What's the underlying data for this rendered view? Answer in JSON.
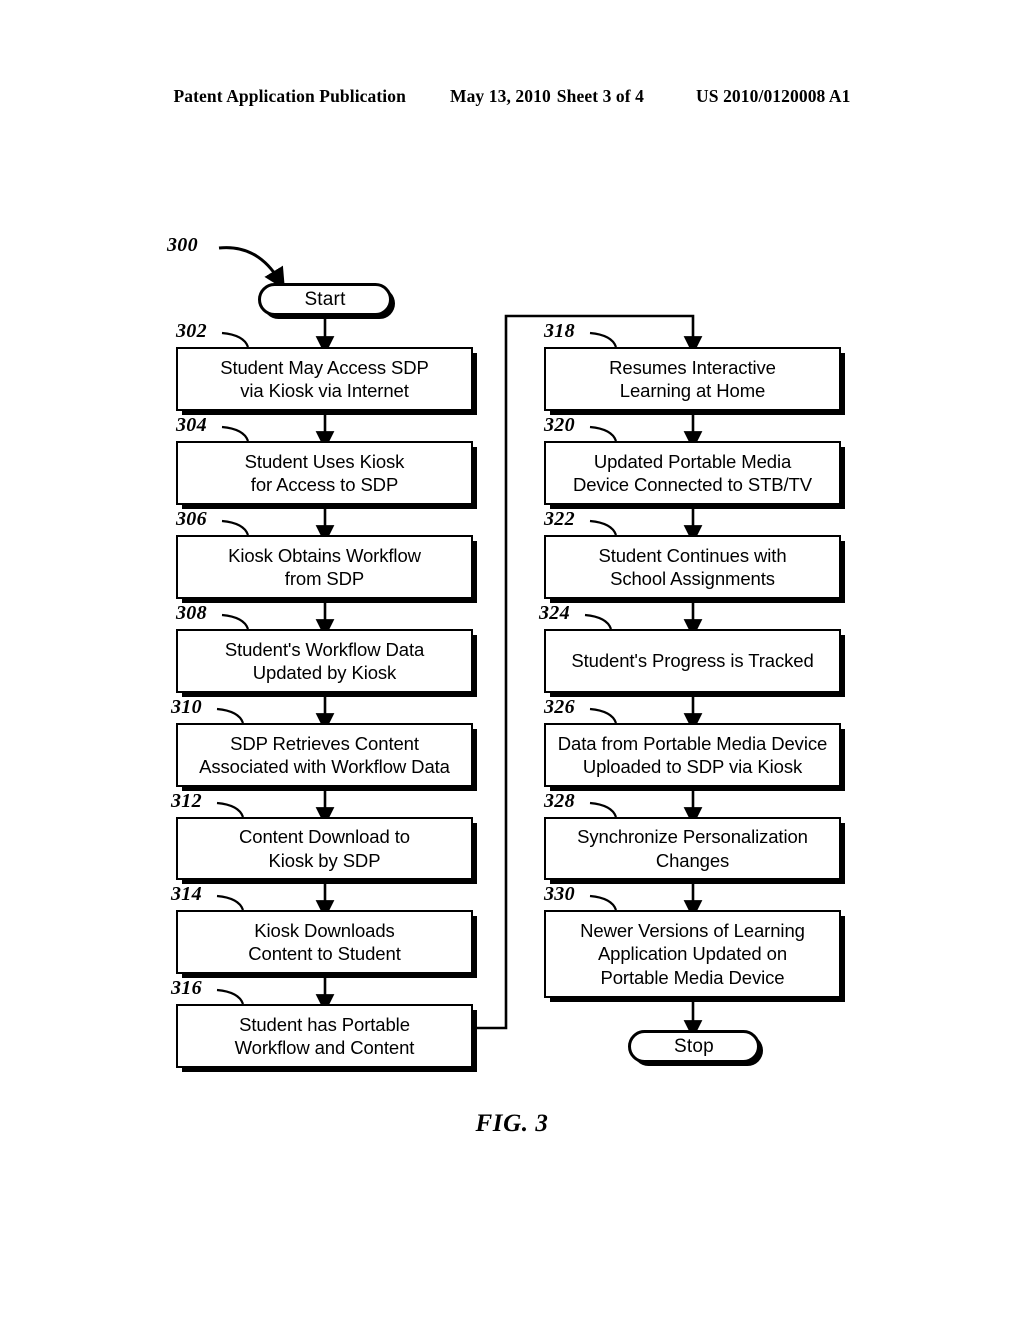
{
  "header": {
    "publication": "Patent Application Publication",
    "date": "May 13, 2010",
    "sheet": "Sheet 3 of 4",
    "patent_number": "US 2010/0120008 A1"
  },
  "figure": {
    "caption": "FIG. 3",
    "diagram_ref": "300",
    "start_label": "Start",
    "stop_label": "Stop"
  },
  "flow": {
    "left_column": [
      {
        "ref": "302",
        "text": "Student May Access SDP\nvia Kiosk via Internet",
        "lines": [
          "Student May Access SDP",
          "via Kiosk via Internet"
        ]
      },
      {
        "ref": "304",
        "text": "Student Uses Kiosk\nfor Access to SDP",
        "lines": [
          "Student Uses Kiosk",
          "for Access to SDP"
        ]
      },
      {
        "ref": "306",
        "text": "Kiosk Obtains Workflow\nfrom SDP",
        "lines": [
          "Kiosk Obtains Workflow",
          "from SDP"
        ]
      },
      {
        "ref": "308",
        "text": "Student's Workflow Data\nUpdated by Kiosk",
        "lines": [
          "Student's Workflow Data",
          "Updated by Kiosk"
        ]
      },
      {
        "ref": "310",
        "text": "SDP Retrieves Content\nAssociated with Workflow Data",
        "lines": [
          "SDP Retrieves Content",
          "Associated with Workflow Data"
        ]
      },
      {
        "ref": "312",
        "text": "Content Download to\nKiosk by SDP",
        "lines": [
          "Content Download to",
          "Kiosk by SDP"
        ]
      },
      {
        "ref": "314",
        "text": "Kiosk Downloads\nContent to Student",
        "lines": [
          "Kiosk Downloads",
          "Content to Student"
        ]
      },
      {
        "ref": "316",
        "text": "Student has Portable\nWorkflow and Content",
        "lines": [
          "Student has Portable",
          "Workflow and Content"
        ]
      }
    ],
    "right_column": [
      {
        "ref": "318",
        "text": "Resumes Interactive\nLearning at Home",
        "lines": [
          "Resumes Interactive",
          "Learning at Home"
        ]
      },
      {
        "ref": "320",
        "text": "Updated Portable Media\nDevice Connected to STB/TV",
        "lines": [
          "Updated Portable Media",
          "Device Connected to STB/TV"
        ]
      },
      {
        "ref": "322",
        "text": "Student Continues with\nSchool Assignments",
        "lines": [
          "Student Continues with",
          "School Assignments"
        ]
      },
      {
        "ref": "324",
        "text": "Student's Progress is Tracked",
        "lines": [
          "Student's Progress is Tracked"
        ]
      },
      {
        "ref": "326",
        "text": "Data from Portable Media Device\nUploaded to SDP via Kiosk",
        "lines": [
          "Data from Portable Media Device",
          "Uploaded to SDP via Kiosk"
        ]
      },
      {
        "ref": "328",
        "text": "Synchronize Personalization\nChanges",
        "lines": [
          "Synchronize Personalization",
          "Changes"
        ]
      },
      {
        "ref": "330",
        "text": "Newer Versions of Learning\nApplication Updated on\nPortable Media Device",
        "lines": [
          "Newer Versions of Learning",
          "Application Updated on",
          "Portable Media Device"
        ]
      }
    ]
  }
}
